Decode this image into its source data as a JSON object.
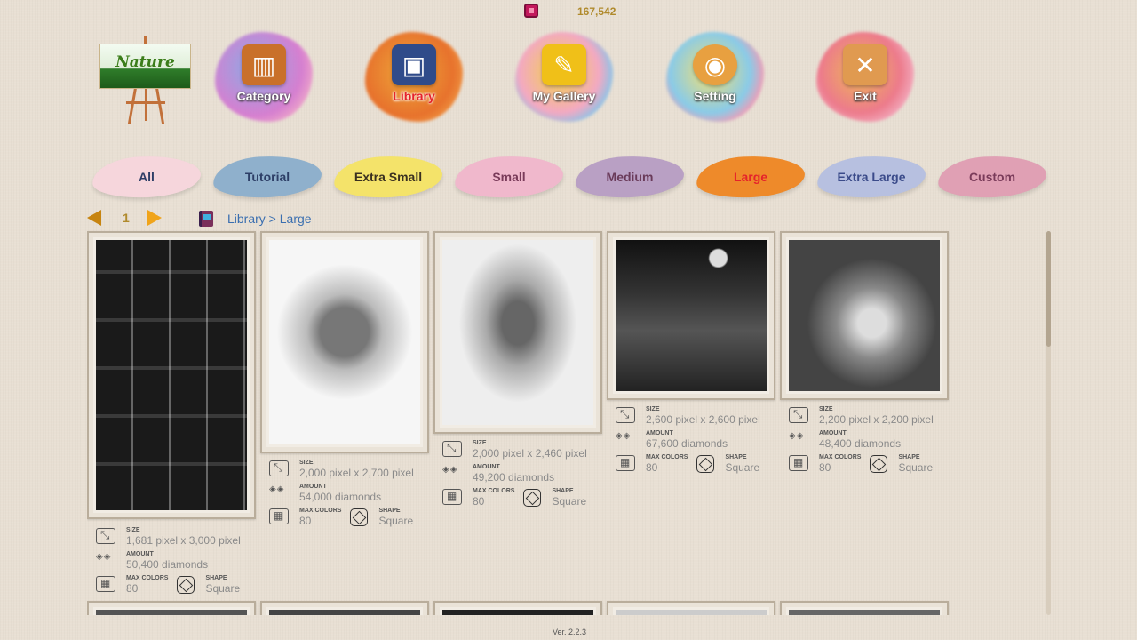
{
  "currency": {
    "value": "167,542"
  },
  "logo": {
    "text": "Nature"
  },
  "nav": {
    "items": [
      {
        "label": "Category",
        "icon": "crayon-box-icon",
        "color": "#4d7ec9"
      },
      {
        "label": "Library",
        "icon": "book-icon",
        "color": "#e8831c",
        "active": true
      },
      {
        "label": "My Gallery",
        "icon": "picture-icon",
        "color": "#f2c018"
      },
      {
        "label": "Setting",
        "icon": "palette-icon",
        "color": "#6fb2de"
      },
      {
        "label": "Exit",
        "icon": "suitcase-icon",
        "color": "#e0708a"
      }
    ]
  },
  "tabs": [
    {
      "label": "All",
      "color": "#f6d6dc",
      "text_color": "#2d3e66"
    },
    {
      "label": "Tutorial",
      "color": "#8fb0cc",
      "text_color": "#2d3e66"
    },
    {
      "label": "Extra Small",
      "color": "#f4e36a",
      "text_color": "#3a3020"
    },
    {
      "label": "Small",
      "color": "#f0b8cc",
      "text_color": "#7a3b5a"
    },
    {
      "label": "Medium",
      "color": "#b9a0c4",
      "text_color": "#6a3b5a"
    },
    {
      "label": "Large",
      "color": "#ee8a2a",
      "text_color": "#e5232b",
      "active": true
    },
    {
      "label": "Extra Large",
      "color": "#b7c0e0",
      "text_color": "#3b4b8a"
    },
    {
      "label": "Custom",
      "color": "#e0a0b4",
      "text_color": "#7a3b5a"
    }
  ],
  "pagination": {
    "page": "1"
  },
  "breadcrumb": {
    "text": "Library > Large"
  },
  "labels": {
    "size": "SIZE",
    "amount": "AMOUNT",
    "max_colors": "MAX COLORS",
    "shape": "SHAPE"
  },
  "cards": [
    {
      "size": "1,681 pixel x 3,000 pixel",
      "amount": "50,400 diamonds",
      "max_colors": "80",
      "shape": "Square"
    },
    {
      "size": "2,000 pixel x 2,700 pixel",
      "amount": "54,000 diamonds",
      "max_colors": "80",
      "shape": "Square"
    },
    {
      "size": "2,000 pixel x 2,460 pixel",
      "amount": "49,200 diamonds",
      "max_colors": "80",
      "shape": "Square"
    },
    {
      "size": "2,600 pixel x 2,600 pixel",
      "amount": "67,600 diamonds",
      "max_colors": "80",
      "shape": "Square"
    },
    {
      "size": "2,200 pixel x 2,200 pixel",
      "amount": "48,400 diamonds",
      "max_colors": "80",
      "shape": "Square"
    }
  ],
  "version": "Ver. 2.2.3"
}
